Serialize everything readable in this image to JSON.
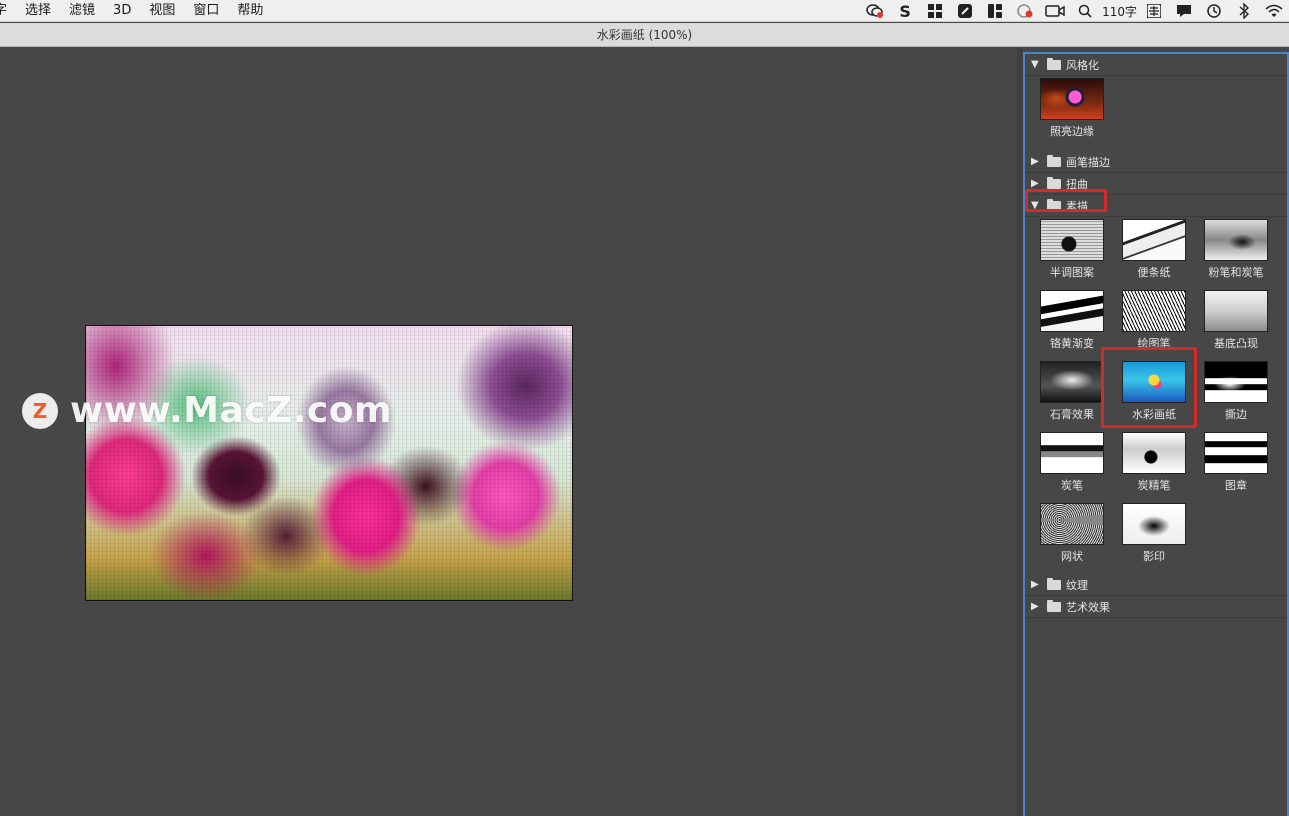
{
  "menubar": {
    "items": [
      "字",
      "选择",
      "滤镜",
      "3D",
      "视图",
      "窗口",
      "帮助"
    ],
    "status_icons": [
      "wechat-icon",
      "s-icon",
      "grid-icon",
      "bear-icon",
      "layout-icon",
      "record-icon",
      "camera-icon",
      "search-icon"
    ],
    "word_count": "110字",
    "right_icons": [
      "input-method-icon",
      "notification-icon",
      "time-machine-icon",
      "bluetooth-icon",
      "wifi-icon"
    ]
  },
  "window": {
    "title": "水彩画纸 (100%)"
  },
  "watermark": {
    "logo_letter": "Z",
    "text": "www.MacZ.com"
  },
  "panel": {
    "groups": [
      {
        "label": "风格化",
        "expanded": true,
        "filters": [
          {
            "label": "照亮边缘",
            "thumb": "glow"
          }
        ]
      },
      {
        "label": "画笔描边",
        "expanded": false,
        "filters": []
      },
      {
        "label": "扭曲",
        "expanded": false,
        "filters": []
      },
      {
        "label": "素描",
        "expanded": true,
        "highlighted": true,
        "filters": [
          {
            "label": "半调图案",
            "thumb": "halftone"
          },
          {
            "label": "便条纸",
            "thumb": "note"
          },
          {
            "label": "粉笔和炭笔",
            "thumb": "chalk"
          },
          {
            "label": "铬黄渐变",
            "thumb": "chrome"
          },
          {
            "label": "绘图笔",
            "thumb": "graphic"
          },
          {
            "label": "基底凸现",
            "thumb": "bas"
          },
          {
            "label": "石膏效果",
            "thumb": "plaster"
          },
          {
            "label": "水彩画纸",
            "thumb": "water",
            "selected": true
          },
          {
            "label": "撕边",
            "thumb": "torn"
          },
          {
            "label": "炭笔",
            "thumb": "charcoal"
          },
          {
            "label": "炭精笔",
            "thumb": "carbon"
          },
          {
            "label": "图章",
            "thumb": "stamp"
          },
          {
            "label": "网状",
            "thumb": "reticulation"
          },
          {
            "label": "影印",
            "thumb": "photocopy"
          }
        ]
      },
      {
        "label": "纹理",
        "expanded": false,
        "filters": []
      },
      {
        "label": "艺术效果",
        "expanded": false,
        "filters": []
      }
    ]
  },
  "colors": {
    "highlight": "#d42a2a",
    "panel_border": "#4a84c9",
    "background": "#474747"
  }
}
